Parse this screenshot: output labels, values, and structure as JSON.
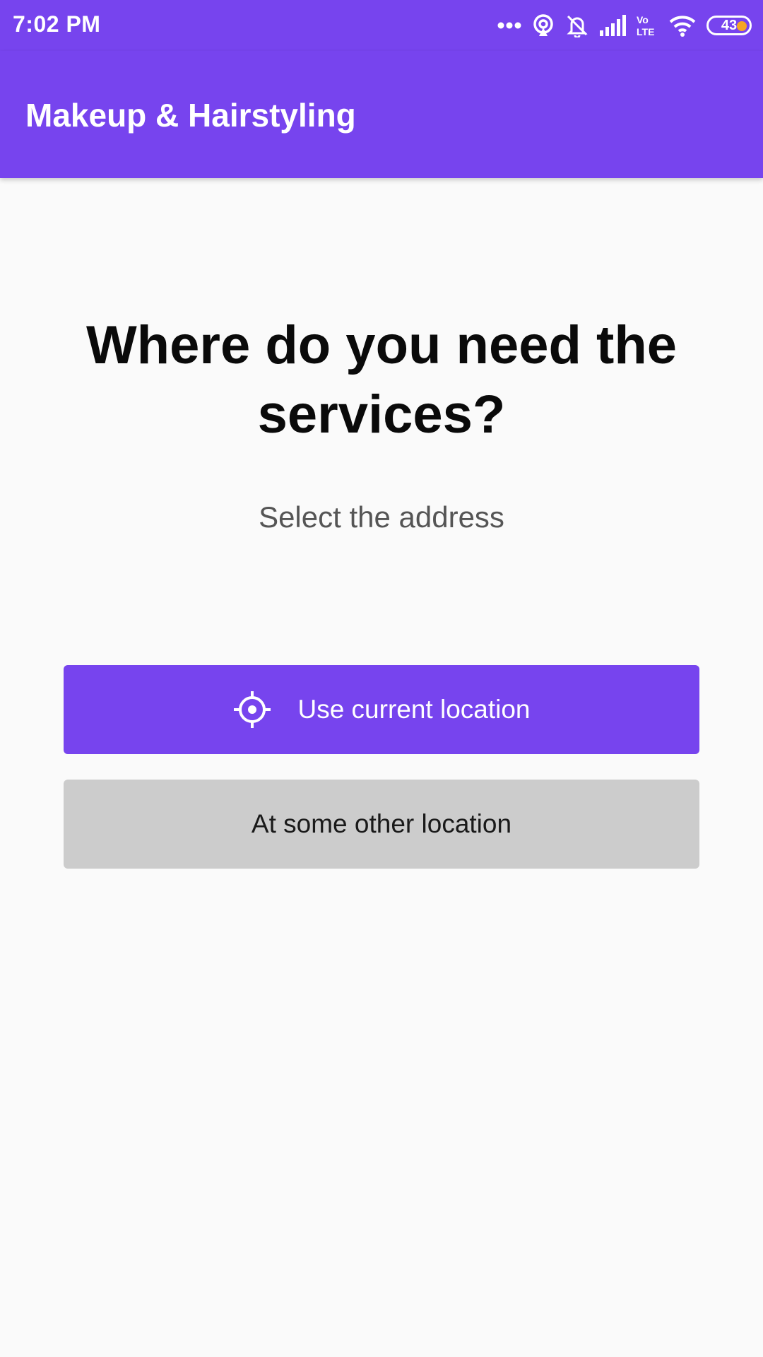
{
  "status_bar": {
    "time": "7:02 PM",
    "battery_level": "43",
    "icons": [
      "more-dots-icon",
      "hotspot-icon",
      "mute-bell-icon",
      "signal-icon",
      "volte-icon",
      "wifi-icon",
      "battery-icon"
    ]
  },
  "app_bar": {
    "title": "Makeup & Hairstyling"
  },
  "main": {
    "heading": "Where do you need the services?",
    "subheading": "Select the address",
    "current_location_button": "Use current location",
    "other_location_button": "At some other location"
  },
  "colors": {
    "primary": "#7744ee",
    "background": "#fafafa",
    "secondary_button": "#cccccc",
    "battery_accent": "#f5a623"
  }
}
